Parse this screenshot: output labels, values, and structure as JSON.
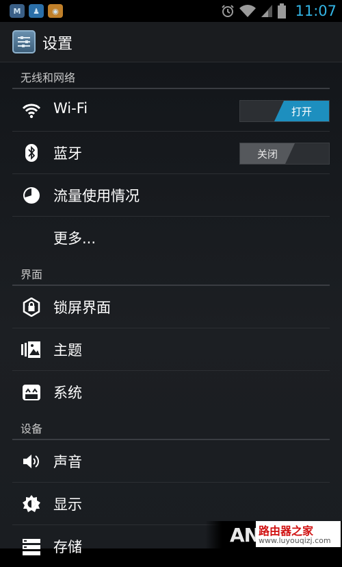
{
  "status_bar": {
    "notifications": [
      {
        "icon": "maxthon-icon",
        "glyph": "M"
      },
      {
        "icon": "qq-icon",
        "glyph": "♟"
      },
      {
        "icon": "weibo-icon",
        "glyph": "◉"
      }
    ],
    "time": "11:07",
    "accent": "#33b5e5"
  },
  "action_bar": {
    "title": "设置",
    "icon": "settings-sliders-icon"
  },
  "sections": [
    {
      "header": "无线和网络",
      "items": [
        {
          "label": "Wi-Fi",
          "icon": "wifi-icon",
          "toggle": "on",
          "toggle_label": "打开"
        },
        {
          "label": "蓝牙",
          "icon": "bluetooth-icon",
          "toggle": "off",
          "toggle_label": "关闭"
        },
        {
          "label": "流量使用情况",
          "icon": "data-usage-icon"
        },
        {
          "label": "更多...",
          "icon": ""
        }
      ]
    },
    {
      "header": "界面",
      "items": [
        {
          "label": "锁屏界面",
          "icon": "lock-screen-icon"
        },
        {
          "label": "主题",
          "icon": "theme-icon"
        },
        {
          "label": "系统",
          "icon": "system-icon"
        }
      ]
    },
    {
      "header": "设备",
      "items": [
        {
          "label": "声音",
          "icon": "sound-icon"
        },
        {
          "label": "显示",
          "icon": "display-icon"
        },
        {
          "label": "存储",
          "icon": "storage-icon"
        }
      ]
    }
  ],
  "watermark": {
    "logo": "AN",
    "site_name": "路由器之家",
    "url": "www.luyouqizj.com"
  },
  "colors": {
    "toggle_on": "#1d8fbf",
    "toggle_off": "#55585c",
    "divider": "#3a3d42"
  }
}
